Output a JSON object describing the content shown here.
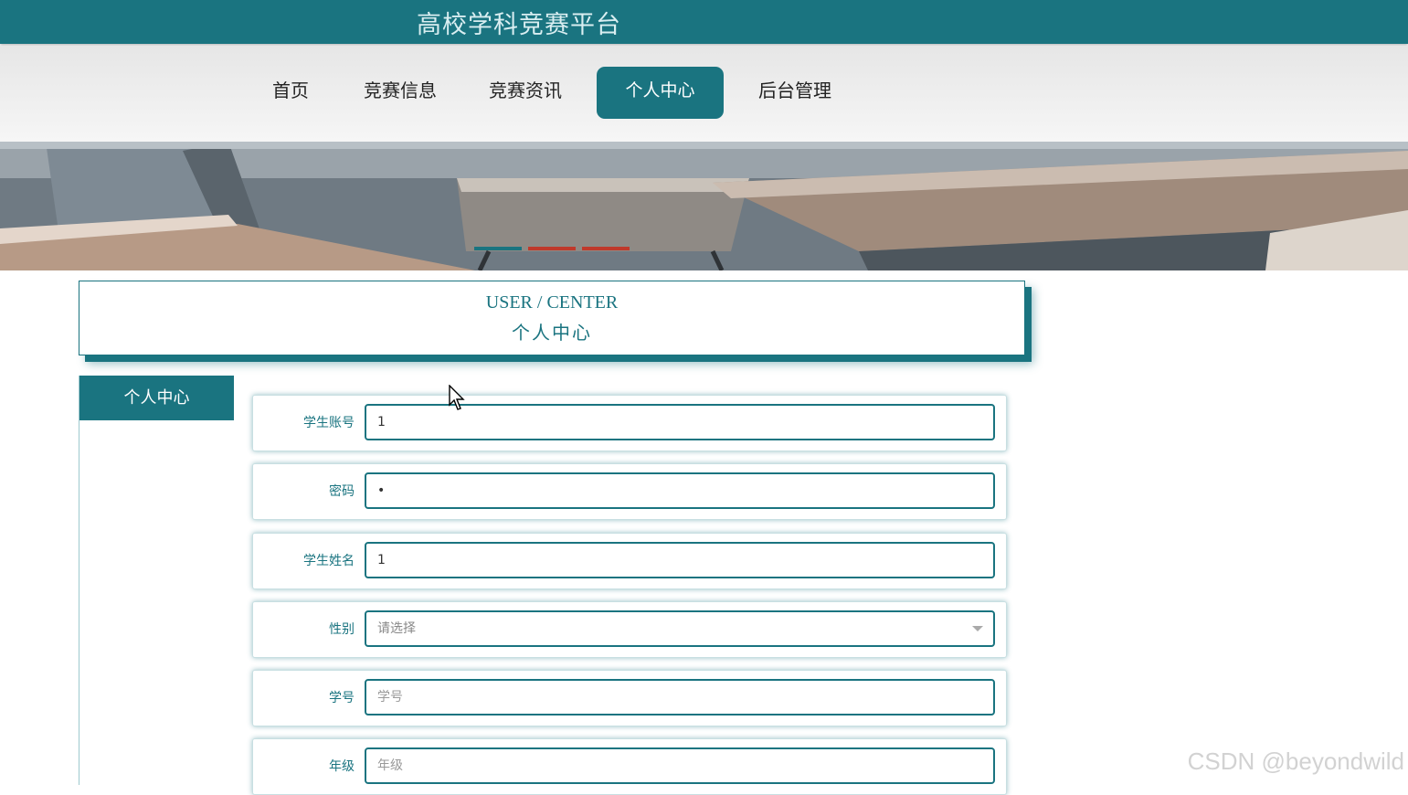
{
  "header": {
    "title": "高校学科竞赛平台"
  },
  "nav": {
    "items": [
      {
        "label": "首页"
      },
      {
        "label": "竞赛信息"
      },
      {
        "label": "竞赛资讯"
      },
      {
        "label": "个人中心",
        "active": true
      },
      {
        "label": "后台管理"
      }
    ]
  },
  "banner": {
    "slides": 3,
    "active_slide": 1
  },
  "section": {
    "title_en": "USER / CENTER",
    "title_cn": "个人中心"
  },
  "sidebar": {
    "title": "个人中心"
  },
  "form": {
    "fields": [
      {
        "label": "学生账号",
        "value": "1",
        "placeholder": ""
      },
      {
        "label": "密码",
        "value": "•",
        "placeholder": ""
      },
      {
        "label": "学生姓名",
        "value": "1",
        "placeholder": ""
      },
      {
        "label": "性别",
        "value": "",
        "placeholder": "请选择"
      },
      {
        "label": "学号",
        "value": "",
        "placeholder": "学号"
      },
      {
        "label": "年级",
        "value": "",
        "placeholder": "年级"
      }
    ]
  },
  "watermark": "CSDN @beyondwild",
  "colors": {
    "primary": "#1a7480",
    "inactive_dot": "#c0392b"
  }
}
